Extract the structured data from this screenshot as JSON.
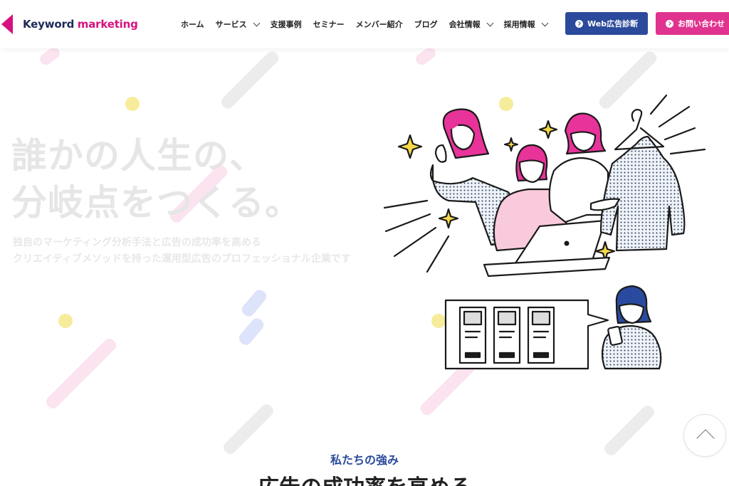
{
  "header": {
    "logo": {
      "text_a": "Keyword",
      "text_b": "marketing"
    },
    "nav": [
      {
        "label": "ホーム",
        "has_dropdown": false
      },
      {
        "label": "サービス",
        "has_dropdown": true
      },
      {
        "label": "支援事例",
        "has_dropdown": false
      },
      {
        "label": "セミナー",
        "has_dropdown": false
      },
      {
        "label": "メンバー紹介",
        "has_dropdown": false
      },
      {
        "label": "ブログ",
        "has_dropdown": false
      },
      {
        "label": "会社情報",
        "has_dropdown": true
      },
      {
        "label": "採用情報",
        "has_dropdown": true
      }
    ],
    "cta_web": "Web広告診断",
    "cta_contact": "お問い合わせ"
  },
  "hero": {
    "title_line1": "誰かの人生の、",
    "title_line2": "分岐点をつくる。",
    "sub_line1": "独自のマーケティング分析手法と広告の成功率を高める",
    "sub_line2": "クリエイティブメソッドを持った運用型広告のプロフェッショナル企業です"
  },
  "section": {
    "label": "私たちの強み",
    "title": "広告の成功率を高める"
  },
  "colors": {
    "brand_blue": "#2b4a9b",
    "brand_pink": "#e0338f",
    "logo_pink": "#d6117f",
    "navy": "#1e2a5a"
  },
  "icons": {
    "scroll_top": "chevron-up-icon",
    "cta_arrow": "arrow-right-circle-icon",
    "dropdown": "chevron-down-icon"
  }
}
